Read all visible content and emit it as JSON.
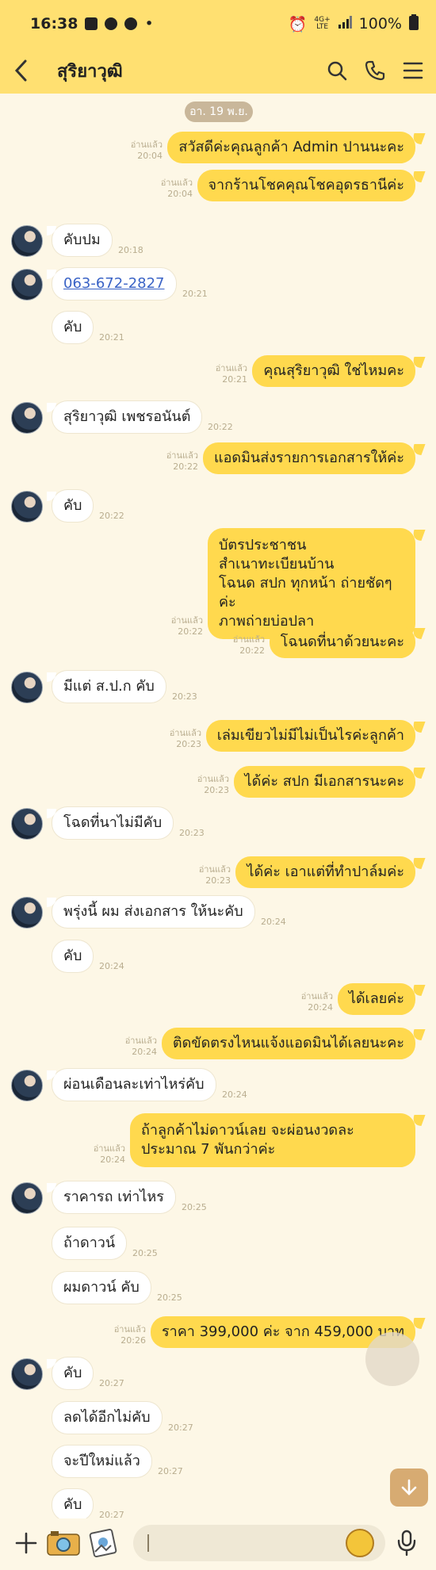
{
  "status_bar": {
    "time": "16:38",
    "network": "4G+",
    "network_sub": "LTE",
    "battery": "100%"
  },
  "header": {
    "title": "สุริยาวุฒิ"
  },
  "date_chip": "อา. 19 พ.ย.",
  "read_label": "อ่านแล้ว",
  "messages": [
    {
      "side": "out",
      "text": "สวัสดีค่ะคุณลูกค้า Admin ปานนะคะ",
      "time": "20:04"
    },
    {
      "side": "out",
      "text": "จากร้านโชคคุณโชคอุดรธานีค่ะ",
      "time": "20:04"
    },
    {
      "side": "in",
      "text": "คับปม",
      "time": "20:18"
    },
    {
      "side": "in",
      "text": "063-672-2827",
      "time": "20:21"
    },
    {
      "side": "in",
      "text": "คับ",
      "time": "20:21"
    },
    {
      "side": "out",
      "text": "คุณสุริยาวุฒิ ใช่ไหมคะ",
      "time": "20:21"
    },
    {
      "side": "in",
      "text": "สุริยาวุฒิ เพชรอนันต์",
      "time": "20:22"
    },
    {
      "side": "out",
      "text": "แอดมินส่งรายการเอกสารให้ค่ะ",
      "time": "20:22"
    },
    {
      "side": "in",
      "text": "คับ",
      "time": "20:22"
    },
    {
      "side": "out",
      "lines": [
        "บัตรประชาชน",
        "สำเนาทะเบียนบ้าน",
        "โฉนด สปก ทุกหน้า ถ่ายชัดๆค่ะ",
        "ภาพถ่ายบ่อปลา"
      ],
      "time": "20:22"
    },
    {
      "side": "out",
      "text": "โฉนดที่นาด้วยนะคะ",
      "time": "20:22"
    },
    {
      "side": "in",
      "text": "มีแต่ ส.ป.ก คับ",
      "time": "20:23"
    },
    {
      "side": "out",
      "text": "เล่มเขียวไม่มีไม่เป็นไรค่ะลูกค้า",
      "time": "20:23"
    },
    {
      "side": "out",
      "text": "ได้ค่ะ สปก มีเอกสารนะคะ",
      "time": "20:23"
    },
    {
      "side": "in",
      "text": "โฉดที่นาไม่มีคับ",
      "time": "20:23"
    },
    {
      "side": "out",
      "text": "ได้ค่ะ เอาแต่ที่ทำปาล์มค่ะ",
      "time": "20:23"
    },
    {
      "side": "in",
      "text": "พรุ่งนี้ ผม ส่งเอกสาร ให้นะคับ",
      "time": "20:24"
    },
    {
      "side": "in",
      "text": "คับ",
      "time": "20:24"
    },
    {
      "side": "out",
      "text": "ได้เลยค่ะ",
      "time": "20:24"
    },
    {
      "side": "out",
      "text": "ติดขัดตรงไหนแจ้งแอดมินได้เลยนะคะ",
      "time": "20:24"
    },
    {
      "side": "in",
      "text": "ผ่อนเดือนละเท่าไหร่คับ",
      "time": "20:24"
    },
    {
      "side": "out",
      "lines": [
        "ถ้าลูกค้าไม่ดาวน์เลย จะผ่อนงวดละ",
        "ประมาณ 7 พันกว่าค่ะ"
      ],
      "time": "20:24"
    },
    {
      "side": "in",
      "text": "ราคารถ เท่าไหร",
      "time": "20:25"
    },
    {
      "side": "in",
      "text": "ถ้าดาวน์",
      "time": "20:25"
    },
    {
      "side": "in",
      "text": "ผมดาวน์ คับ",
      "time": "20:25"
    },
    {
      "side": "out",
      "text": "ราคา 399,000 ค่ะ จาก 459,000 บาท",
      "time": "20:26"
    },
    {
      "side": "in",
      "text": "คับ",
      "time": "20:27"
    },
    {
      "side": "in",
      "text": "ลดได้อีกไม่คับ",
      "time": "20:27"
    },
    {
      "side": "in",
      "text": "จะปีใหม่แล้ว",
      "time": "20:27"
    },
    {
      "side": "in",
      "text": "คับ",
      "time": "20:27"
    }
  ]
}
